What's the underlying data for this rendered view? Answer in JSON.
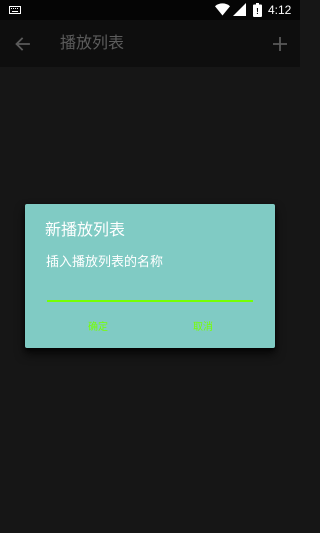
{
  "status_bar": {
    "time": "4:12",
    "icons": [
      "keyboard-icon",
      "wifi-icon",
      "signal-icon",
      "battery-icon"
    ]
  },
  "app_bar": {
    "title": "播放列表",
    "back_icon": "arrow-back-icon",
    "add_icon": "add-icon"
  },
  "dialog": {
    "title": "新播放列表",
    "message": "插入播放列表的名称",
    "input_value": "",
    "confirm_label": "确定",
    "cancel_label": "取消"
  },
  "colors": {
    "background": "#161616",
    "app_bar": "#0e0e0e",
    "status_bar": "#050505",
    "dialog": "#80cbc4",
    "accent": "#76ff03",
    "title_text": "#5c5c5c"
  }
}
